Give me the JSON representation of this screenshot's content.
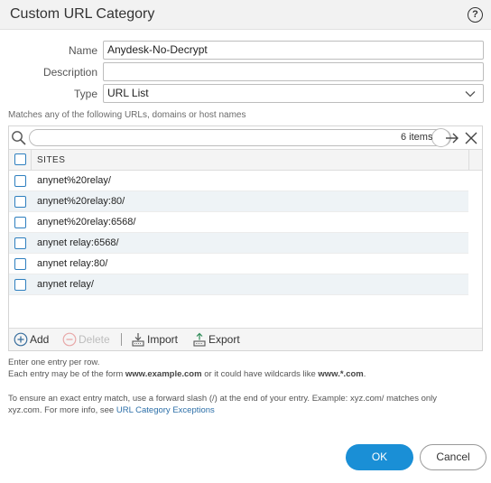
{
  "dialog": {
    "title": "Custom URL Category",
    "help_glyph": "?"
  },
  "form": {
    "name_label": "Name",
    "name_value": "Anydesk-No-Decrypt",
    "description_label": "Description",
    "description_value": "",
    "type_label": "Type",
    "type_value": "URL List"
  },
  "hint": "Matches any of the following URLs, domains or host names",
  "grid": {
    "search_placeholder": "",
    "item_count": "6 items",
    "column_header": "SITES",
    "rows": [
      "anynet%20relay/",
      "anynet%20relay:80/",
      "anynet%20relay:6568/",
      "anynet relay:6568/",
      "anynet relay:80/",
      "anynet relay/"
    ]
  },
  "toolbar": {
    "add": "Add",
    "delete": "Delete",
    "import": "Import",
    "export": "Export"
  },
  "notes": {
    "line1": "Enter one entry per row.",
    "line2_prefix": "Each entry may be of the form ",
    "line2_example1": "www.example.com",
    "line2_mid": " or it could have wildcards like ",
    "line2_example2": "www.*.com",
    "line2_suffix": ".",
    "line3": "To ensure an exact entry match, use a forward slash (/) at the end of your entry. Example: xyz.com/ matches only",
    "line4_prefix": "xyz.com. For more info, see ",
    "line4_link": "URL Category Exceptions"
  },
  "buttons": {
    "ok": "OK",
    "cancel": "Cancel"
  },
  "colors": {
    "accent": "#1a8fd6",
    "checkbox": "#2e7fbf",
    "link": "#2c6fa8",
    "row_alt": "#eef3f6"
  }
}
